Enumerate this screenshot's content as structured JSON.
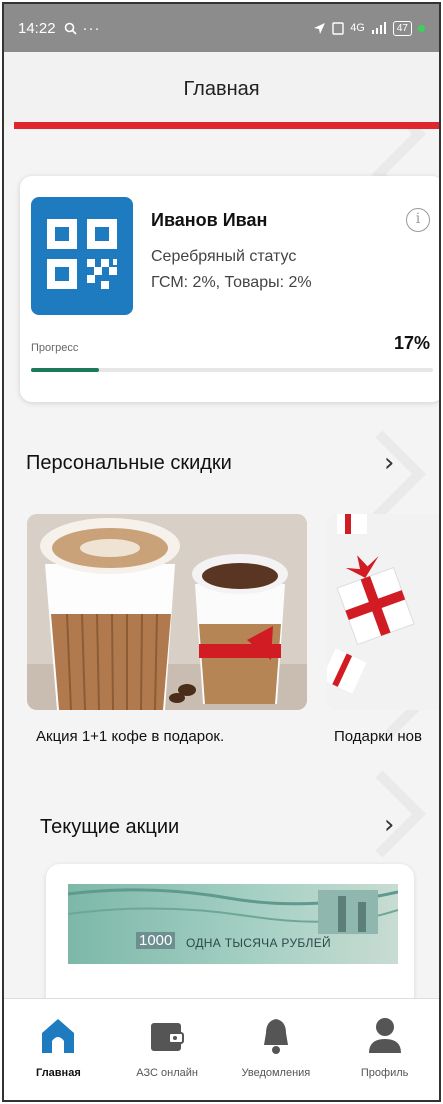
{
  "status_bar": {
    "time": "14:22",
    "battery": "47",
    "network": "4G"
  },
  "header": {
    "title": "Главная"
  },
  "colors": {
    "accent_red": "#e0262c",
    "brand_blue": "#1e7bbf",
    "progress_green": "#1b7a5a"
  },
  "loyalty": {
    "name": "Иванов Иван",
    "status": "Серебряный статус",
    "rates": "ГСМ: 2%, Товары: 2%",
    "progress_label": "Прогресс",
    "progress_text": "17%",
    "progress_value": 0.17
  },
  "personal_discounts": {
    "title": "Персональные скидки",
    "items": [
      {
        "caption": "Акция 1+1 кофе в подарок.",
        "icon": "coffee-cups-image"
      },
      {
        "caption": "Подарки нов",
        "icon": "gift-boxes-image"
      }
    ]
  },
  "current_promos": {
    "title": "Текущие акции",
    "banner": {
      "denomination": "1000",
      "words": "ОДНА ТЫСЯЧА РУБЛЕЙ"
    }
  },
  "tabbar": {
    "tabs": [
      {
        "label": "Главная",
        "icon": "home-icon"
      },
      {
        "label": "АЗС онлайн",
        "icon": "wallet-icon"
      },
      {
        "label": "Уведомления",
        "icon": "bell-icon"
      },
      {
        "label": "Профиль",
        "icon": "profile-icon"
      }
    ]
  }
}
